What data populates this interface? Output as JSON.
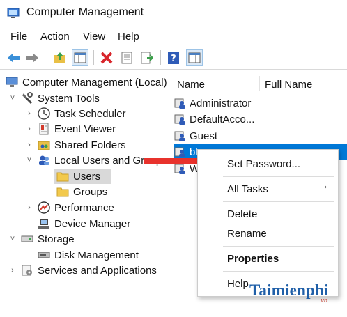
{
  "window": {
    "title": "Computer Management"
  },
  "menu": [
    "File",
    "Action",
    "View",
    "Help"
  ],
  "tree": {
    "items": [
      {
        "label": "Computer Management (Local)",
        "icon": "computer-management-icon"
      },
      {
        "label": "System Tools",
        "icon": "system-tools-icon",
        "chevron": "˅"
      },
      {
        "label": "Task Scheduler",
        "icon": "task-scheduler-icon",
        "chevron": "›"
      },
      {
        "label": "Event Viewer",
        "icon": "event-viewer-icon",
        "chevron": "›"
      },
      {
        "label": "Shared Folders",
        "icon": "shared-folders-icon",
        "chevron": "›"
      },
      {
        "label": "Local Users and Groups",
        "icon": "local-users-groups-icon",
        "chevron": "˅"
      },
      {
        "label": "Users",
        "icon": "folder-icon"
      },
      {
        "label": "Groups",
        "icon": "folder-icon"
      },
      {
        "label": "Performance",
        "icon": "performance-icon",
        "chevron": "›"
      },
      {
        "label": "Device Manager",
        "icon": "device-manager-icon"
      },
      {
        "label": "Storage",
        "icon": "storage-icon",
        "chevron": "˅"
      },
      {
        "label": "Disk Management",
        "icon": "disk-management-icon"
      },
      {
        "label": "Services and Applications",
        "icon": "services-applications-icon",
        "chevron": "›"
      }
    ]
  },
  "list": {
    "columns": [
      "Name",
      "Full Name"
    ],
    "rows": [
      {
        "name": "Administrator"
      },
      {
        "name": "DefaultAcco..."
      },
      {
        "name": "Guest"
      },
      {
        "name": "bl"
      },
      {
        "name": "W"
      }
    ]
  },
  "context_menu": {
    "items": [
      "Set Password...",
      "All Tasks",
      "Delete",
      "Rename",
      "Properties",
      "Help"
    ],
    "submenu_arrow": "›"
  },
  "watermark": {
    "text": "Taimienphi",
    "suffix": ".vn"
  },
  "colors": {
    "selection": "#0078d7",
    "arrow": "#e8322c",
    "folder": "#f2c94c"
  }
}
